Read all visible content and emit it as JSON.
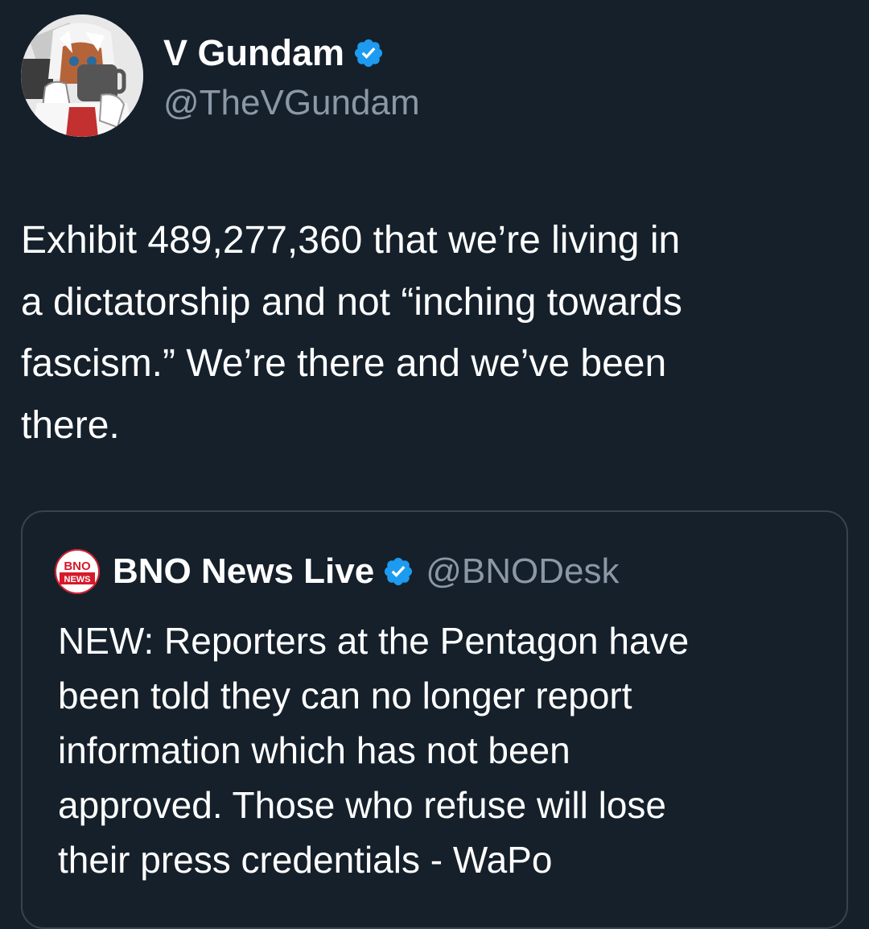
{
  "tweet": {
    "author": {
      "name": "V Gundam",
      "handle": "@TheVGundam",
      "avatar_icon": "avatar-image",
      "verified_icon": "verified-badge-icon"
    },
    "text_lines": [
      "Exhibit 489,277,360 that we’re living in",
      "a dictatorship and not “inching towards",
      "fascism.” We’re there and we’ve been",
      "there."
    ]
  },
  "quote": {
    "logo_text_top": "BNO",
    "logo_text_bottom": "NEWS",
    "name": "BNO News Live",
    "handle": "@BNODesk",
    "verified_icon": "verified-badge-icon",
    "text_lines": [
      "NEW: Reporters at the Pentagon have",
      "been told they can no longer report",
      "information which has not been",
      "approved. Those who refuse will lose",
      "their press credentials - WaPo"
    ]
  },
  "colors": {
    "background": "#15202b",
    "text_primary": "#ffffff",
    "text_secondary": "#8b98a5",
    "verified_blue": "#1d9bf0",
    "card_border": "#38444d",
    "bno_red": "#d7192a"
  }
}
